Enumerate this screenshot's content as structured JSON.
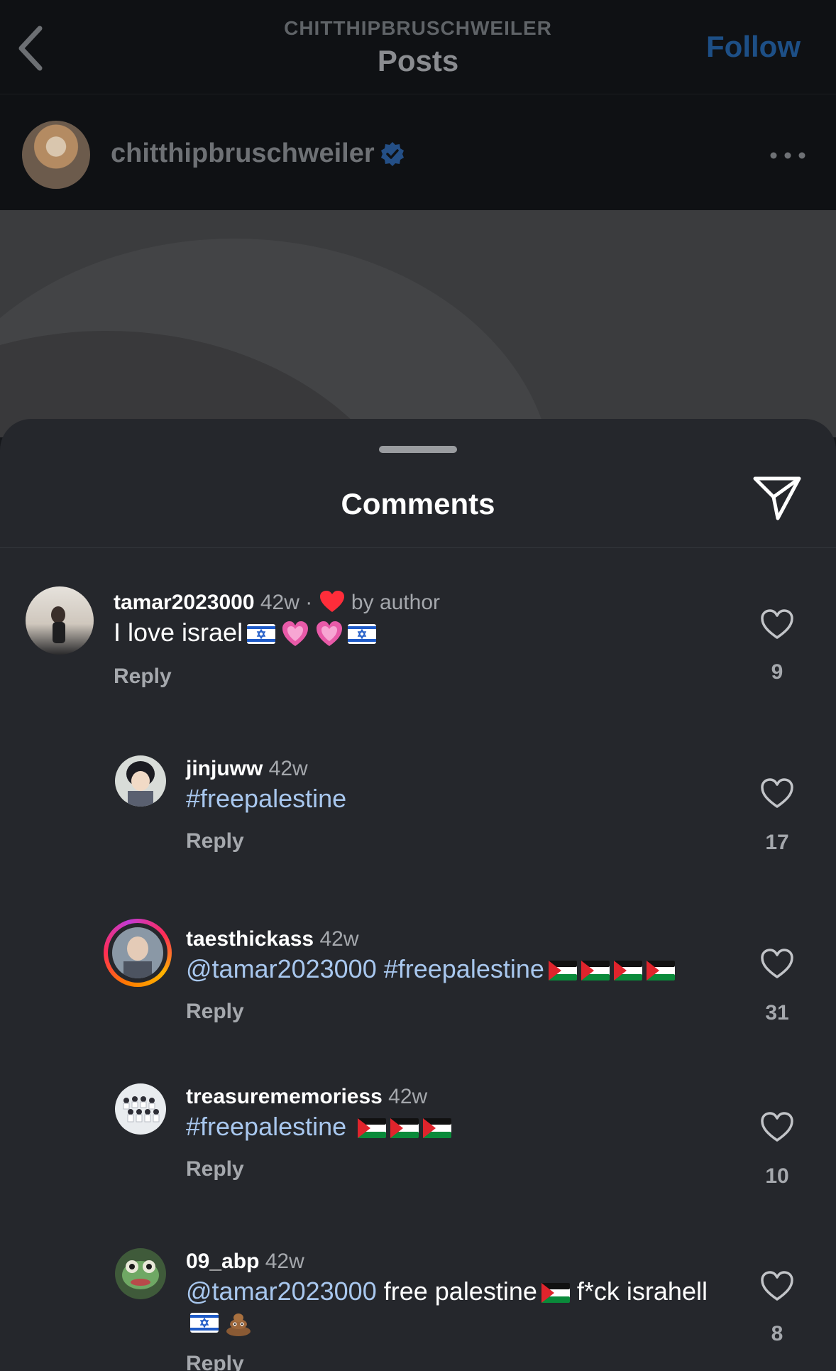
{
  "header": {
    "account_small": "CHITTHIPBRUSCHWEILER",
    "title": "Posts",
    "follow_label": "Follow"
  },
  "profile": {
    "username": "chitthipbruschweiler"
  },
  "sheet": {
    "title": "Comments"
  },
  "comments": [
    {
      "username": "tamar2023000",
      "time": "42w",
      "separator": " · ",
      "author_like": "by author",
      "text": "I love israel",
      "reply": "Reply",
      "likes": "9"
    },
    {
      "username": "jinjuww",
      "time": "42w",
      "text": "#freepalestine",
      "reply": "Reply",
      "likes": "17"
    },
    {
      "username": "taesthickass",
      "time": "42w",
      "mention": "@tamar2023000",
      "text": "#freepalestine",
      "reply": "Reply",
      "likes": "31"
    },
    {
      "username": "treasurememoriess",
      "time": "42w",
      "text": "#freepalestine",
      "reply": "Reply",
      "likes": "10"
    },
    {
      "username": "09_abp",
      "time": "42w",
      "mention": "@tamar2023000",
      "text1": "free palestine",
      "text2": "f*ck",
      "text3": "israhell",
      "reply": "Reply",
      "likes": "8"
    }
  ],
  "colors": {
    "sheet_bg": "#25272c",
    "hashtag": "#a8c7ee",
    "follow": "#1d4f86",
    "verified": "#3897f0",
    "heart_red": "#ff2d3a"
  },
  "icons": {
    "back": "chevron-left-icon",
    "verified": "verified-badge-icon",
    "more": "more-horizontal-icon",
    "share": "send-icon",
    "like": "heart-outline-icon"
  }
}
